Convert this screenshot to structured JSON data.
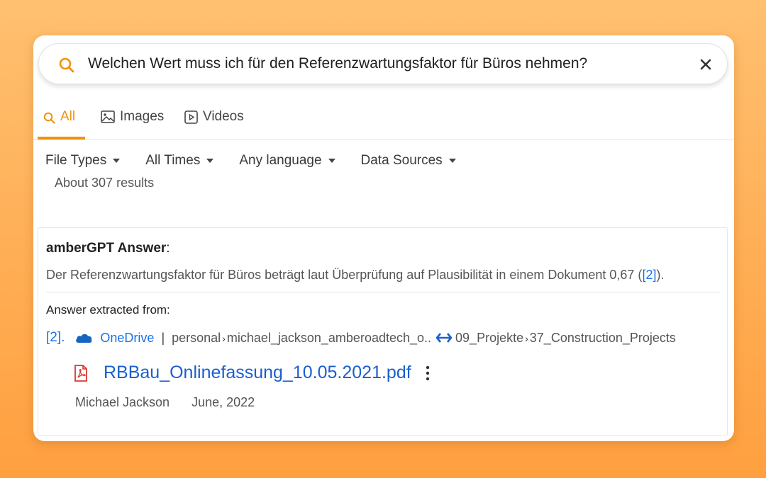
{
  "search": {
    "query": "Welchen Wert muss ich für den Referenzwartungsfaktor für Büros nehmen?"
  },
  "tabs": [
    {
      "label": "All",
      "active": true,
      "icon": "search-icon"
    },
    {
      "label": "Images",
      "active": false,
      "icon": "image-icon"
    },
    {
      "label": "Videos",
      "active": false,
      "icon": "video-icon"
    }
  ],
  "filters": [
    {
      "label": "File Types"
    },
    {
      "label": "All Times"
    },
    {
      "label": "Any language"
    },
    {
      "label": "Data Sources"
    }
  ],
  "results_count": "About 307 results",
  "answer": {
    "title_bold": "amberGPT Answer",
    "title_colon": ":",
    "text_before": "Der Referenzwartungsfaktor für Büros beträgt laut Überprüfung auf Plausibilität in einem Dokument 0,67 (",
    "ref": "[2]",
    "text_after": ").",
    "extracted_label": "Answer extracted from:"
  },
  "source": {
    "number": "[2].",
    "provider": "OneDrive",
    "separator": "|",
    "path_part1": "personal",
    "path_part2": "michael_jackson_amberoadtech_o..",
    "path_part3": "09_Projekte",
    "path_part4": "37_Construction_Projects",
    "chevron": "›",
    "file_title": "RBBau_Onlinefassung_10.05.2021.pdf",
    "author": "Michael Jackson",
    "date": "June, 2022"
  },
  "colors": {
    "accent": "#f0930c",
    "link": "#1a73e8",
    "pdf": "#d9392e",
    "onedrive": "#1565c0"
  }
}
